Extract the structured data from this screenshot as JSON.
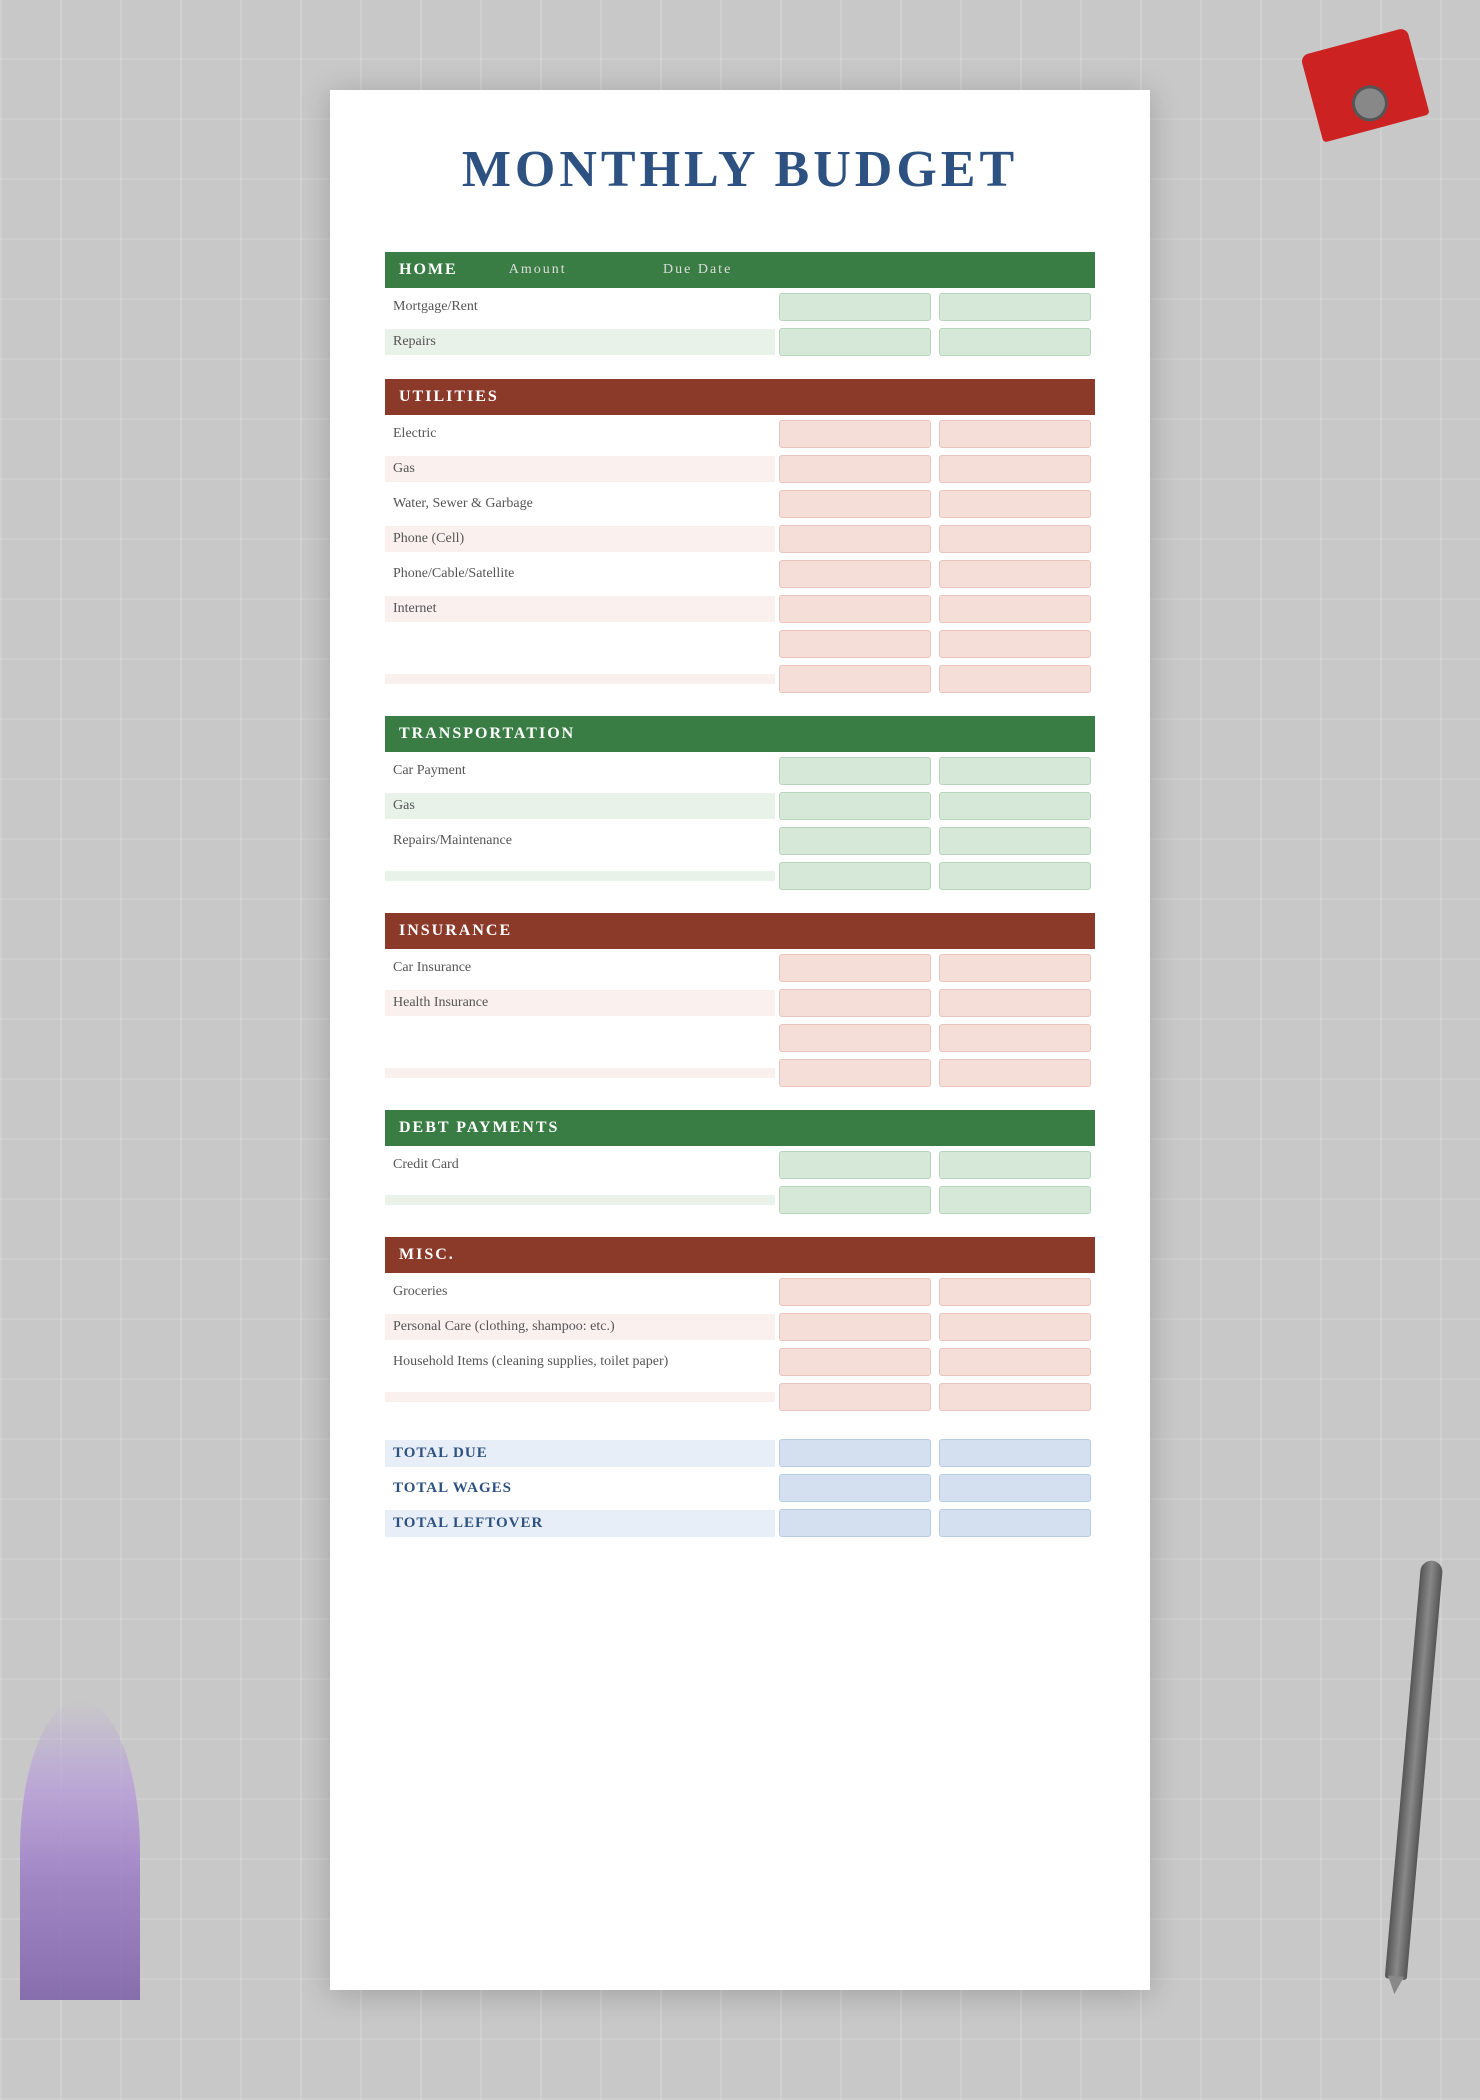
{
  "title": "MONTHLY BUDGET",
  "sections": [
    {
      "id": "home",
      "label": "HOME",
      "color": "green",
      "showColHeaders": true,
      "colHeaders": {
        "amount": "Amount",
        "dueDate": "Due Date"
      },
      "rows": [
        {
          "label": "Mortgage/Rent",
          "shade": "plain",
          "inputColor": "green"
        },
        {
          "label": "Repairs",
          "shade": "green",
          "inputColor": "green"
        }
      ]
    },
    {
      "id": "utilities",
      "label": "UTILITIES",
      "color": "brown",
      "rows": [
        {
          "label": "Electric",
          "shade": "plain",
          "inputColor": "pink"
        },
        {
          "label": "Gas",
          "shade": "pink",
          "inputColor": "pink"
        },
        {
          "label": "Water, Sewer & Garbage",
          "shade": "plain",
          "inputColor": "pink"
        },
        {
          "label": "Phone (Cell)",
          "shade": "pink",
          "inputColor": "pink"
        },
        {
          "label": "Phone/Cable/Satellite",
          "shade": "plain",
          "inputColor": "pink"
        },
        {
          "label": "Internet",
          "shade": "pink",
          "inputColor": "pink"
        },
        {
          "label": "",
          "shade": "plain",
          "inputColor": "pink"
        },
        {
          "label": "",
          "shade": "pink",
          "inputColor": "pink"
        }
      ]
    },
    {
      "id": "transportation",
      "label": "TRANSPORTATION",
      "color": "green",
      "rows": [
        {
          "label": "Car Payment",
          "shade": "plain",
          "inputColor": "green"
        },
        {
          "label": "Gas",
          "shade": "green",
          "inputColor": "green"
        },
        {
          "label": "Repairs/Maintenance",
          "shade": "plain",
          "inputColor": "green"
        },
        {
          "label": "",
          "shade": "green",
          "inputColor": "green"
        }
      ]
    },
    {
      "id": "insurance",
      "label": "INSURANCE",
      "color": "brown",
      "rows": [
        {
          "label": "Car Insurance",
          "shade": "plain",
          "inputColor": "pink"
        },
        {
          "label": "Health Insurance",
          "shade": "pink",
          "inputColor": "pink"
        },
        {
          "label": "",
          "shade": "plain",
          "inputColor": "pink"
        },
        {
          "label": "",
          "shade": "pink",
          "inputColor": "pink"
        }
      ]
    },
    {
      "id": "debt",
      "label": "DEBT PAYMENTS",
      "color": "green",
      "rows": [
        {
          "label": "Credit Card",
          "shade": "plain",
          "inputColor": "green"
        },
        {
          "label": "",
          "shade": "green",
          "inputColor": "green"
        }
      ]
    },
    {
      "id": "misc",
      "label": "MISC.",
      "color": "brown",
      "rows": [
        {
          "label": "Groceries",
          "shade": "plain",
          "inputColor": "pink"
        },
        {
          "label": "Personal Care (clothing, shampoo: etc.)",
          "shade": "pink",
          "inputColor": "pink"
        },
        {
          "label": "Household Items (cleaning supplies, toilet paper)",
          "shade": "plain",
          "inputColor": "pink"
        },
        {
          "label": "",
          "shade": "pink",
          "inputColor": "pink"
        }
      ]
    }
  ],
  "totals": [
    {
      "label": "TOTAL DUE",
      "shade": "blue",
      "inputColor": "blue"
    },
    {
      "label": "TOTAL WAGES",
      "shade": "plain",
      "inputColor": "blue"
    },
    {
      "label": "TOTAL LEFTOVER",
      "shade": "blue",
      "inputColor": "blue"
    }
  ]
}
